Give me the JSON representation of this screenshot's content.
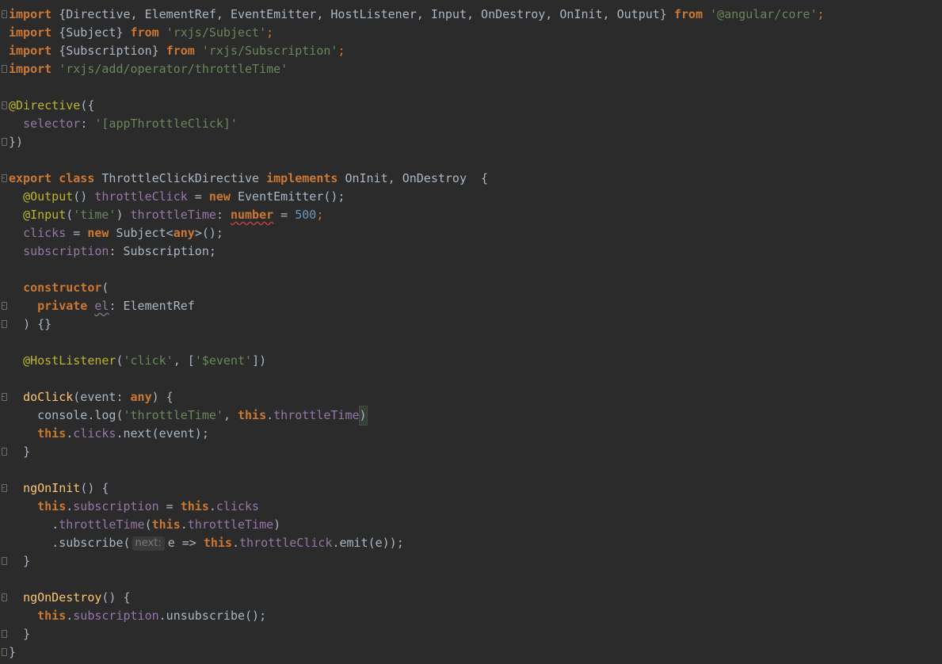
{
  "editor": {
    "lines": [
      [
        {
          "t": "import",
          "c": "kw"
        },
        {
          "t": " {Directive, ElementRef, EventEmitter, HostListener, Input, OnDestroy, OnInit, Output} ",
          "c": "plain"
        },
        {
          "t": "from",
          "c": "kw"
        },
        {
          "t": " ",
          "c": "plain"
        },
        {
          "t": "'@angular/core'",
          "c": "str"
        },
        {
          "t": ";",
          "c": "kwn"
        }
      ],
      [
        {
          "t": "import",
          "c": "kw"
        },
        {
          "t": " {Subject} ",
          "c": "plain"
        },
        {
          "t": "from",
          "c": "kw"
        },
        {
          "t": " ",
          "c": "plain"
        },
        {
          "t": "'rxjs/Subject'",
          "c": "str"
        },
        {
          "t": ";",
          "c": "kwn"
        }
      ],
      [
        {
          "t": "import",
          "c": "kw"
        },
        {
          "t": " {Subscription} ",
          "c": "plain"
        },
        {
          "t": "from",
          "c": "kw"
        },
        {
          "t": " ",
          "c": "plain"
        },
        {
          "t": "'rxjs/Subscription'",
          "c": "str"
        },
        {
          "t": ";",
          "c": "kwn"
        }
      ],
      [
        {
          "t": "import",
          "c": "kw"
        },
        {
          "t": " ",
          "c": "plain"
        },
        {
          "t": "'rxjs/add/operator/throttleTime'",
          "c": "str"
        }
      ],
      [],
      [
        {
          "t": "@Directive",
          "c": "ann"
        },
        {
          "t": "({",
          "c": "plain"
        }
      ],
      [
        {
          "t": "  ",
          "c": "indent"
        },
        {
          "t": "selector",
          "c": "fld"
        },
        {
          "t": ": ",
          "c": "plain"
        },
        {
          "t": "'[appThrottleClick]'",
          "c": "str"
        }
      ],
      [
        {
          "t": "})",
          "c": "plain"
        }
      ],
      [],
      [
        {
          "t": "export",
          "c": "kw"
        },
        {
          "t": " ",
          "c": "plain"
        },
        {
          "t": "class",
          "c": "kw"
        },
        {
          "t": " ThrottleClickDirective ",
          "c": "plain"
        },
        {
          "t": "implements",
          "c": "kw"
        },
        {
          "t": " OnInit, OnDestroy  {",
          "c": "plain"
        }
      ],
      [
        {
          "t": "  ",
          "c": "indent"
        },
        {
          "t": "@Output",
          "c": "ann"
        },
        {
          "t": "() ",
          "c": "plain"
        },
        {
          "t": "throttleClick",
          "c": "fld"
        },
        {
          "t": " = ",
          "c": "plain"
        },
        {
          "t": "new",
          "c": "kw"
        },
        {
          "t": " EventEmitter();",
          "c": "plain"
        }
      ],
      [
        {
          "t": "  ",
          "c": "indent"
        },
        {
          "t": "@Input",
          "c": "ann"
        },
        {
          "t": "(",
          "c": "plain"
        },
        {
          "t": "'time'",
          "c": "str"
        },
        {
          "t": ") ",
          "c": "plain"
        },
        {
          "t": "throttleTime",
          "c": "fld"
        },
        {
          "t": ": ",
          "c": "plain"
        },
        {
          "t": "number",
          "c": "kw typo"
        },
        {
          "t": " = ",
          "c": "plain"
        },
        {
          "t": "500",
          "c": "num"
        },
        {
          "t": ";",
          "c": "kwn"
        }
      ],
      [
        {
          "t": "  ",
          "c": "indent"
        },
        {
          "t": "clicks",
          "c": "fld"
        },
        {
          "t": " = ",
          "c": "plain"
        },
        {
          "t": "new",
          "c": "kw"
        },
        {
          "t": " Subject<",
          "c": "plain"
        },
        {
          "t": "any",
          "c": "kw"
        },
        {
          "t": ">();",
          "c": "plain"
        }
      ],
      [
        {
          "t": "  ",
          "c": "indent"
        },
        {
          "t": "subscription",
          "c": "fld"
        },
        {
          "t": ": Subscription;",
          "c": "plain"
        }
      ],
      [],
      [
        {
          "t": "  ",
          "c": "indent"
        },
        {
          "t": "constructor",
          "c": "kw"
        },
        {
          "t": "(",
          "c": "plain"
        }
      ],
      [
        {
          "t": "    ",
          "c": "indent"
        },
        {
          "t": "private",
          "c": "kw"
        },
        {
          "t": " ",
          "c": "plain"
        },
        {
          "t": "el",
          "c": "fld weak"
        },
        {
          "t": ": ElementRef",
          "c": "plain"
        }
      ],
      [
        {
          "t": "  ",
          "c": "indent"
        },
        {
          "t": ") {}",
          "c": "plain"
        }
      ],
      [],
      [
        {
          "t": "  ",
          "c": "indent"
        },
        {
          "t": "@HostListener",
          "c": "ann"
        },
        {
          "t": "(",
          "c": "plain"
        },
        {
          "t": "'click'",
          "c": "str"
        },
        {
          "t": ", [",
          "c": "plain"
        },
        {
          "t": "'$event'",
          "c": "str"
        },
        {
          "t": "])",
          "c": "plain"
        }
      ],
      [],
      [
        {
          "t": "  ",
          "c": "indent"
        },
        {
          "t": "doClick",
          "c": "fn"
        },
        {
          "t": "(event: ",
          "c": "plain"
        },
        {
          "t": "any",
          "c": "kw"
        },
        {
          "t": ") {",
          "c": "plain"
        }
      ],
      [
        {
          "t": "    ",
          "c": "indent"
        },
        {
          "t": "console.log(",
          "c": "plain"
        },
        {
          "t": "'throttleTime'",
          "c": "str"
        },
        {
          "t": ", ",
          "c": "plain"
        },
        {
          "t": "this",
          "c": "kw"
        },
        {
          "t": ".",
          "c": "plain"
        },
        {
          "t": "throttleTime",
          "c": "fld"
        },
        {
          "t": ")",
          "c": "plain caret-box"
        }
      ],
      [
        {
          "t": "    ",
          "c": "indent"
        },
        {
          "t": "this",
          "c": "kw"
        },
        {
          "t": ".",
          "c": "plain"
        },
        {
          "t": "clicks",
          "c": "fld"
        },
        {
          "t": ".next(event);",
          "c": "plain"
        }
      ],
      [
        {
          "t": "  ",
          "c": "indent"
        },
        {
          "t": "}",
          "c": "plain"
        }
      ],
      [],
      [
        {
          "t": "  ",
          "c": "indent"
        },
        {
          "t": "ngOnInit",
          "c": "fn"
        },
        {
          "t": "() {",
          "c": "plain"
        }
      ],
      [
        {
          "t": "    ",
          "c": "indent"
        },
        {
          "t": "this",
          "c": "kw"
        },
        {
          "t": ".",
          "c": "plain"
        },
        {
          "t": "subscription",
          "c": "fld"
        },
        {
          "t": " = ",
          "c": "plain"
        },
        {
          "t": "this",
          "c": "kw"
        },
        {
          "t": ".",
          "c": "plain"
        },
        {
          "t": "clicks",
          "c": "fld"
        }
      ],
      [
        {
          "t": "      ",
          "c": "indent"
        },
        {
          "t": ".",
          "c": "plain"
        },
        {
          "t": "throttleTime",
          "c": "fld"
        },
        {
          "t": "(",
          "c": "plain"
        },
        {
          "t": "this",
          "c": "kw"
        },
        {
          "t": ".",
          "c": "plain"
        },
        {
          "t": "throttleTime",
          "c": "fld"
        },
        {
          "t": ")",
          "c": "plain"
        }
      ],
      [
        {
          "t": "      ",
          "c": "indent"
        },
        {
          "t": ".subscribe(",
          "c": "plain"
        },
        {
          "t": "next:",
          "c": "hint"
        },
        {
          "t": "e => ",
          "c": "plain"
        },
        {
          "t": "this",
          "c": "kw"
        },
        {
          "t": ".",
          "c": "plain"
        },
        {
          "t": "throttleClick",
          "c": "fld"
        },
        {
          "t": ".emit(e));",
          "c": "plain"
        }
      ],
      [
        {
          "t": "  ",
          "c": "indent"
        },
        {
          "t": "}",
          "c": "plain"
        }
      ],
      [],
      [
        {
          "t": "  ",
          "c": "indent"
        },
        {
          "t": "ngOnDestroy",
          "c": "fn"
        },
        {
          "t": "() {",
          "c": "plain"
        }
      ],
      [
        {
          "t": "    ",
          "c": "indent"
        },
        {
          "t": "this",
          "c": "kw"
        },
        {
          "t": ".",
          "c": "plain"
        },
        {
          "t": "subscription",
          "c": "fld"
        },
        {
          "t": ".unsubscribe();",
          "c": "plain"
        }
      ],
      [
        {
          "t": "  ",
          "c": "indent"
        },
        {
          "t": "}",
          "c": "plain"
        }
      ],
      [
        {
          "t": "}",
          "c": "plain"
        }
      ]
    ],
    "folds": {
      "0": "open",
      "3": "close",
      "5": "open",
      "7": "close",
      "9": "open",
      "16": "open",
      "17": "close",
      "21": "open",
      "24": "close",
      "26": "open",
      "30": "close",
      "32": "open",
      "34": "close",
      "35": "close"
    }
  }
}
